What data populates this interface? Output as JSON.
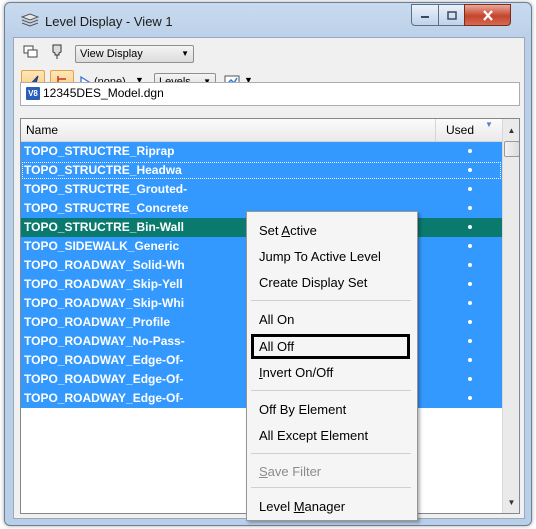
{
  "window": {
    "title": "Level Display - View 1"
  },
  "toolbar": {
    "view_display": "View Display",
    "none_label": "(none)",
    "levels_label": "Levels"
  },
  "file": {
    "name": "12345DES_Model.dgn",
    "badge": "V8"
  },
  "list": {
    "header_name": "Name",
    "header_used": "Used",
    "rows": [
      "TOPO_STRUCTRE_Riprap",
      "TOPO_STRUCTRE_Headwa",
      "TOPO_STRUCTRE_Grouted-",
      "TOPO_STRUCTRE_Concrete",
      "TOPO_STRUCTRE_Bin-Wall",
      "TOPO_SIDEWALK_Generic",
      "TOPO_ROADWAY_Solid-Wh",
      "TOPO_ROADWAY_Skip-Yell",
      "TOPO_ROADWAY_Skip-Whi",
      "TOPO_ROADWAY_Profile",
      "TOPO_ROADWAY_No-Pass-",
      "TOPO_ROADWAY_Edge-Of-",
      "TOPO_ROADWAY_Edge-Of-",
      "TOPO_ROADWAY_Edge-Of-"
    ]
  },
  "context_menu": {
    "set_active_pre": "Set ",
    "set_active_u": "A",
    "set_active_post": "ctive",
    "jump": "Jump To Active Level",
    "create_display_set": "Create Display Set",
    "all_on": "All On",
    "all_off": "All Off",
    "invert_u": "I",
    "invert_post": "nvert On/Off",
    "off_by_element": "Off By Element",
    "all_except_element": "All Except Element",
    "save_filter_u": "S",
    "save_filter_post": "ave Filter",
    "level_pre": "Level ",
    "level_u": "M",
    "level_post": "anager"
  },
  "colors": {
    "selection": "#3399ff",
    "active_row": "#0b7a6e",
    "title_bg": "#c9daee",
    "close_button": "#c5452d"
  }
}
